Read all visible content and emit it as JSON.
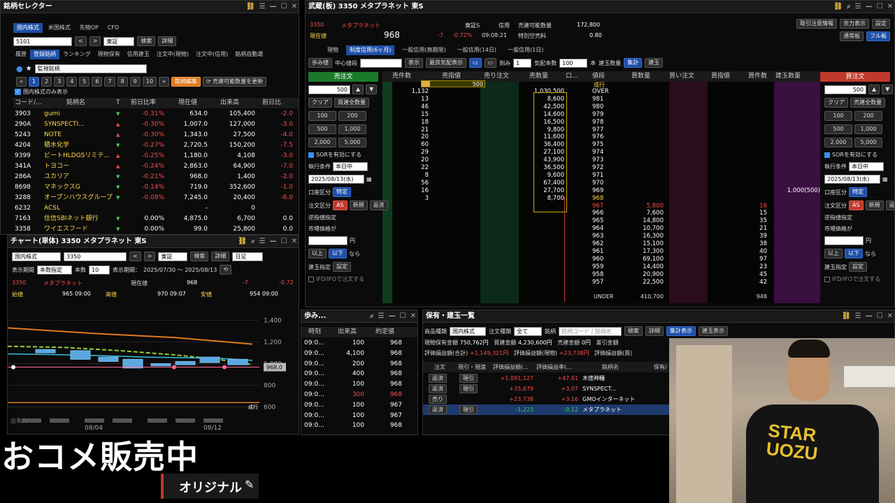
{
  "selector": {
    "title": "銘柄セレクター",
    "market_tabs": [
      "国内株式",
      "米国株式",
      "先物OP",
      "CFD"
    ],
    "code_value": "5101",
    "exchange": "東証",
    "search_btn": "検索",
    "detail_btn": "詳細",
    "nav_tabs": [
      "履歴",
      "登録銘柄",
      "ランキング",
      "現物保有",
      "信用建玉",
      "注文中(現物)",
      "注文中(信用)",
      "銘柄自動選"
    ],
    "list_name": "監視銘柄",
    "pages": [
      "1",
      "2",
      "3",
      "4",
      "5",
      "6",
      "7",
      "8",
      "9",
      "10"
    ],
    "edit_btn": "銘柄編集",
    "update_btn": "売建可能数量を更新",
    "domestic_only": "国内株式のみ表示",
    "columns": [
      "コード/...",
      "銘柄名",
      "T",
      "前日比率",
      "現在値",
      "出来高",
      "前日比"
    ],
    "rows": [
      {
        "code": "3903",
        "name": "gumi",
        "dir": "down",
        "pct": "-0.31%",
        "price": "634.0",
        "volume": "105,400",
        "chg": "-2.0"
      },
      {
        "code": "290A",
        "name": "SYNSPECTI...",
        "dir": "up",
        "pct": "-0.30%",
        "price": "1,007.0",
        "volume": "127,000",
        "chg": "-3.0"
      },
      {
        "code": "5243",
        "name": "NOTE",
        "dir": "up",
        "pct": "-0.30%",
        "price": "1,343.0",
        "volume": "27,500",
        "chg": "-4.0"
      },
      {
        "code": "4204",
        "name": "積水化学",
        "dir": "down",
        "pct": "-0.27%",
        "price": "2,720.5",
        "volume": "150,200",
        "chg": "-7.5"
      },
      {
        "code": "9399",
        "name": "ビートHLDGSリミテ...",
        "dir": "up",
        "pct": "-0.25%",
        "price": "1,180.0",
        "volume": "4,108",
        "chg": "-3.0"
      },
      {
        "code": "341A",
        "name": "トヨコー",
        "dir": "up",
        "pct": "-0.24%",
        "price": "2,863.0",
        "volume": "64,900",
        "chg": "-7.0"
      },
      {
        "code": "286A",
        "name": "ユカリア",
        "dir": "down",
        "pct": "-0.21%",
        "price": "968.0",
        "volume": "1,400",
        "chg": "-2.0"
      },
      {
        "code": "8698",
        "name": "マネックスG",
        "dir": "down",
        "pct": "-0.14%",
        "price": "719.0",
        "volume": "352,600",
        "chg": "-1.0"
      },
      {
        "code": "3288",
        "name": "オープンハウスグループ",
        "dir": "down",
        "pct": "-0.08%",
        "price": "7,245.0",
        "volume": "20,400",
        "chg": "-6.0"
      },
      {
        "code": "6232",
        "name": "ACSL",
        "dir": "",
        "pct": "",
        "price": "-",
        "volume": "0",
        "chg": ""
      },
      {
        "code": "7163",
        "name": "住信SBIネット銀行",
        "dir": "down",
        "pct": "0.00%",
        "price": "4,875.0",
        "volume": "6,700",
        "chg": "0.0"
      },
      {
        "code": "3358",
        "name": "ワイエスフード",
        "dir": "down",
        "pct": "0.00%",
        "price": "99.0",
        "volume": "25,800",
        "chg": "0.0"
      }
    ]
  },
  "chart": {
    "title": "チャート(単体) 3350 メタプラネット 東S",
    "market": "国内株式",
    "code": "3350",
    "exchange": "東証",
    "search_btn": "検索",
    "detail_btn": "詳細",
    "period_type": "日足",
    "display_label": "表示期間",
    "display_value": "本数指定",
    "count_label": "本数",
    "count_value": "10",
    "range_label": "表示期間：",
    "range_value": "2025/07/30 ～ 2025/08/13",
    "stock_code": "3350",
    "stock_name": "メタプラネット",
    "current_label": "現在値",
    "current_value": "968",
    "change": "-7",
    "change_pct": "-0.72",
    "open_label": "始値",
    "open_value": "965 09:00",
    "high_label": "高値",
    "high_value": "970 09:07",
    "low_label": "安値",
    "low_value": "954 09:00",
    "price_marker": "968.0",
    "volume_label": "出来高",
    "order_tag": "成行",
    "chart_data": {
      "type": "line",
      "y_ticks": [
        "1,400",
        "1,200",
        "1,000",
        "800",
        "600"
      ],
      "x_labels": [
        "08/04",
        "08/12"
      ],
      "ylim": [
        500,
        1500
      ]
    }
  },
  "board": {
    "title": "武蔵(板) 3350 メタプラネット 東S",
    "code": "3350",
    "name": "メタプラネット",
    "exchange": "東証S",
    "margin_label": "信用",
    "sellable_label": "売建可能数量",
    "sellable_value": "172,800",
    "current_label": "現在値",
    "current_value": "968",
    "change": "-7",
    "change_pct": "-0.72%",
    "time": "09:08:21",
    "special_label": "特別空売料",
    "special_value": "0.80",
    "top_btns": [
      "取引注意情報",
      "余力表示",
      "設定"
    ],
    "view_btns": [
      "通常板",
      "フル板"
    ],
    "trade_tabs": [
      "現物",
      "制度信用(6ヶ月)",
      "一般信用(無期限)",
      "一般信用(14日)",
      "一般信用(1日)"
    ],
    "toolbar": {
      "ayumi": "歩み値",
      "center": "中心値段",
      "show": "表示",
      "best": "最良気配表示",
      "tick_label": "刻み",
      "tick_value": "1",
      "qty_label": "気配本数",
      "qty_value": "100",
      "unit_label": "本",
      "pos_qty": "建玉数量",
      "total": "集計",
      "pos": "建玉"
    },
    "sell_order": "売注文",
    "buy_order": "買注文",
    "columns": [
      "売件数",
      "売指値",
      "売り注文",
      "売数量",
      "ロ...",
      "値段",
      "買数量",
      "買い注文",
      "買指値",
      "買件数",
      "建玉数量"
    ],
    "marker_500": "500",
    "rows": [
      {
        "sell_cnt": "1,132",
        "sell_qty": "1,030,500",
        "price": "OVER",
        "buy_qty": "",
        "buy_cnt": "",
        "pos": ""
      },
      {
        "sell_cnt": "13",
        "sell_qty": "8,600",
        "price": "981",
        "buy_qty": "",
        "buy_cnt": "",
        "pos": ""
      },
      {
        "sell_cnt": "46",
        "sell_qty": "42,500",
        "price": "980",
        "buy_qty": "",
        "buy_cnt": "",
        "pos": ""
      },
      {
        "sell_cnt": "15",
        "sell_qty": "14,600",
        "price": "979",
        "buy_qty": "",
        "buy_cnt": "",
        "pos": ""
      },
      {
        "sell_cnt": "18",
        "sell_qty": "16,500",
        "price": "978",
        "buy_qty": "",
        "buy_cnt": "",
        "pos": ""
      },
      {
        "sell_cnt": "21",
        "sell_qty": "9,800",
        "price": "977",
        "buy_qty": "",
        "buy_cnt": "",
        "pos": ""
      },
      {
        "sell_cnt": "20",
        "sell_qty": "11,600",
        "price": "976",
        "buy_qty": "",
        "buy_cnt": "",
        "pos": ""
      },
      {
        "sell_cnt": "60",
        "sell_qty": "36,400",
        "price": "975",
        "buy_qty": "",
        "buy_cnt": "",
        "pos": ""
      },
      {
        "sell_cnt": "29",
        "sell_qty": "27,100",
        "price": "974",
        "buy_qty": "",
        "buy_cnt": "",
        "pos": ""
      },
      {
        "sell_cnt": "20",
        "sell_qty": "43,900",
        "price": "973",
        "buy_qty": "",
        "buy_cnt": "",
        "pos": ""
      },
      {
        "sell_cnt": "22",
        "sell_qty": "36,500",
        "price": "972",
        "buy_qty": "",
        "buy_cnt": "",
        "pos": ""
      },
      {
        "sell_cnt": "8",
        "sell_qty": "9,600",
        "price": "971",
        "buy_qty": "",
        "buy_cnt": "",
        "pos": ""
      },
      {
        "sell_cnt": "56",
        "sell_qty": "67,400",
        "price": "970",
        "buy_qty": "",
        "buy_cnt": "",
        "pos": ""
      },
      {
        "sell_cnt": "16",
        "sell_qty": "27,700",
        "price": "969",
        "buy_qty": "",
        "buy_cnt": "",
        "pos": "1,000(500)"
      },
      {
        "sell_cnt": "3",
        "sell_qty": "8,700",
        "price": "968",
        "buy_qty": "",
        "buy_cnt": "",
        "pos": ""
      },
      {
        "sell_cnt": "",
        "sell_qty": "",
        "price": "967",
        "buy_qty": "5,800",
        "buy_cnt": "16",
        "pos": ""
      },
      {
        "sell_cnt": "",
        "sell_qty": "",
        "price": "966",
        "buy_qty": "7,600",
        "buy_cnt": "15",
        "pos": ""
      },
      {
        "sell_cnt": "",
        "sell_qty": "",
        "price": "965",
        "buy_qty": "14,800",
        "buy_cnt": "35",
        "pos": ""
      },
      {
        "sell_cnt": "",
        "sell_qty": "",
        "price": "964",
        "buy_qty": "10,700",
        "buy_cnt": "21",
        "pos": ""
      },
      {
        "sell_cnt": "",
        "sell_qty": "",
        "price": "963",
        "buy_qty": "16,300",
        "buy_cnt": "39",
        "pos": ""
      },
      {
        "sell_cnt": "",
        "sell_qty": "",
        "price": "962",
        "buy_qty": "15,100",
        "buy_cnt": "38",
        "pos": ""
      },
      {
        "sell_cnt": "",
        "sell_qty": "",
        "price": "961",
        "buy_qty": "17,300",
        "buy_cnt": "40",
        "pos": ""
      },
      {
        "sell_cnt": "",
        "sell_qty": "",
        "price": "960",
        "buy_qty": "69,100",
        "buy_cnt": "97",
        "pos": ""
      },
      {
        "sell_cnt": "",
        "sell_qty": "",
        "price": "959",
        "buy_qty": "14,400",
        "buy_cnt": "23",
        "pos": ""
      },
      {
        "sell_cnt": "",
        "sell_qty": "",
        "price": "958",
        "buy_qty": "20,900",
        "buy_cnt": "45",
        "pos": ""
      },
      {
        "sell_cnt": "",
        "sell_qty": "",
        "price": "957",
        "buy_qty": "22,500",
        "buy_cnt": "42",
        "pos": ""
      }
    ],
    "market_label": "成行",
    "under_label": "UNDER",
    "under_qty": "410,700",
    "under_cnt": "948",
    "left_form": {
      "qty": "500",
      "clear": "クリア",
      "sell_all": "買建全数量",
      "q_btns": [
        "100",
        "200",
        "500",
        "1,000",
        "2,000",
        "5,000"
      ],
      "sor": "SORを有効にする",
      "cond_label": "執行条件",
      "cond_value": "本日中",
      "date": "2025/08/13(水)",
      "acct_label": "口座区分",
      "acct_value": "特定",
      "type_label": "注文区分",
      "as": "AS",
      "new": "新規",
      "close": "返済",
      "stop_label": "逆指値指定",
      "market_price": "市場価格が",
      "yen": "円",
      "above": "以上",
      "below": "以下",
      "then": "なら",
      "pos_label": "建玉指定",
      "setting": "設定",
      "ifd": "IFD/IFOで注文する"
    },
    "right_form": {
      "qty": "500",
      "clear": "クリア",
      "sell_all": "売建全数量",
      "q_btns": [
        "100",
        "200",
        "500",
        "1,000",
        "2,000",
        "5,000"
      ],
      "sor": "SORを有効にする",
      "cond_label": "執行条件",
      "cond_value": "本日中",
      "date": "2025/08/13(水)",
      "acct_label": "口座区分",
      "acct_value": "特定",
      "type_label": "注文区分",
      "as": "AS",
      "new": "新規",
      "close": "返済",
      "stop_label": "逆指値指定",
      "market_price": "市場価格が",
      "yen": "円",
      "above": "以上",
      "below": "以下",
      "then": "なら",
      "pos_label": "建玉指定",
      "setting": "設定",
      "ifd": "IFD/IFOで注文する"
    }
  },
  "ayumi": {
    "title": "歩み...",
    "columns": [
      "時刻",
      "出来高",
      "約定値"
    ],
    "rows": [
      {
        "time": "09:0...",
        "qty": "100",
        "price": "968",
        "color": "white"
      },
      {
        "time": "09:0...",
        "qty": "4,100",
        "price": "968",
        "color": "white"
      },
      {
        "time": "09:0...",
        "qty": "200",
        "price": "968",
        "color": "white"
      },
      {
        "time": "09:0...",
        "qty": "400",
        "price": "968",
        "color": "white"
      },
      {
        "time": "09:0...",
        "qty": "100",
        "price": "968",
        "color": "white"
      },
      {
        "time": "09:0...",
        "qty": "300",
        "price": "968",
        "color": "red"
      },
      {
        "time": "09:0...",
        "qty": "100",
        "price": "967",
        "color": "white"
      },
      {
        "time": "09:0...",
        "qty": "100",
        "price": "967",
        "color": "white"
      },
      {
        "time": "09:0...",
        "qty": "100",
        "price": "968",
        "color": "white"
      }
    ]
  },
  "holdings": {
    "title": "保有・建玉一覧",
    "type_label": "商品種類",
    "type_value": "国内株式",
    "order_type_label": "注文種類",
    "order_type_value": "全て",
    "stock_label": "銘柄",
    "stock_placeholder": "銘柄コード / 銘柄名",
    "search": "検索",
    "detail": "詳細",
    "total_view": "集計表示",
    "pos_view": "建玉表示",
    "spot_label": "現物保有金額",
    "spot_value": "750,762円",
    "buy_label": "買建金額",
    "buy_value": "4,230,600円",
    "sell_label": "売建金額",
    "sell_value": "0円",
    "margin_label": "差引金額",
    "pl_total_label": "評価損益額(合計)",
    "pl_total_value": "+1,149,321円",
    "pl_spot_label": "評価損益額(現物)",
    "pl_spot_value": "+23,738円",
    "pl_margin_label": "評価損益額(買)",
    "columns": [
      "注文",
      "現引・現渡",
      "評価損益額(...",
      "評価損益率(...",
      "銘柄名",
      "保有/"
    ],
    "rows": [
      {
        "action": "返済",
        "settle": "現引",
        "pl": "+1,091,127",
        "rate": "+47.61",
        "name": "木徳神糧"
      },
      {
        "action": "返済",
        "settle": "現引",
        "pl": "+35,679",
        "rate": "+3.07",
        "name": "SYNSPECT..."
      },
      {
        "action": "売り",
        "settle": "",
        "pl": "+23,738",
        "rate": "+3.16",
        "name": "GMOインターネット"
      },
      {
        "action": "返済",
        "settle": "現引",
        "pl": "-1,223",
        "rate": "-0.12",
        "name": "メタプラネット"
      }
    ]
  },
  "overlay": {
    "big_text": "おコメ販売中",
    "sub_text": "オリジナル",
    "shirt_text": "STAR UOZU"
  }
}
